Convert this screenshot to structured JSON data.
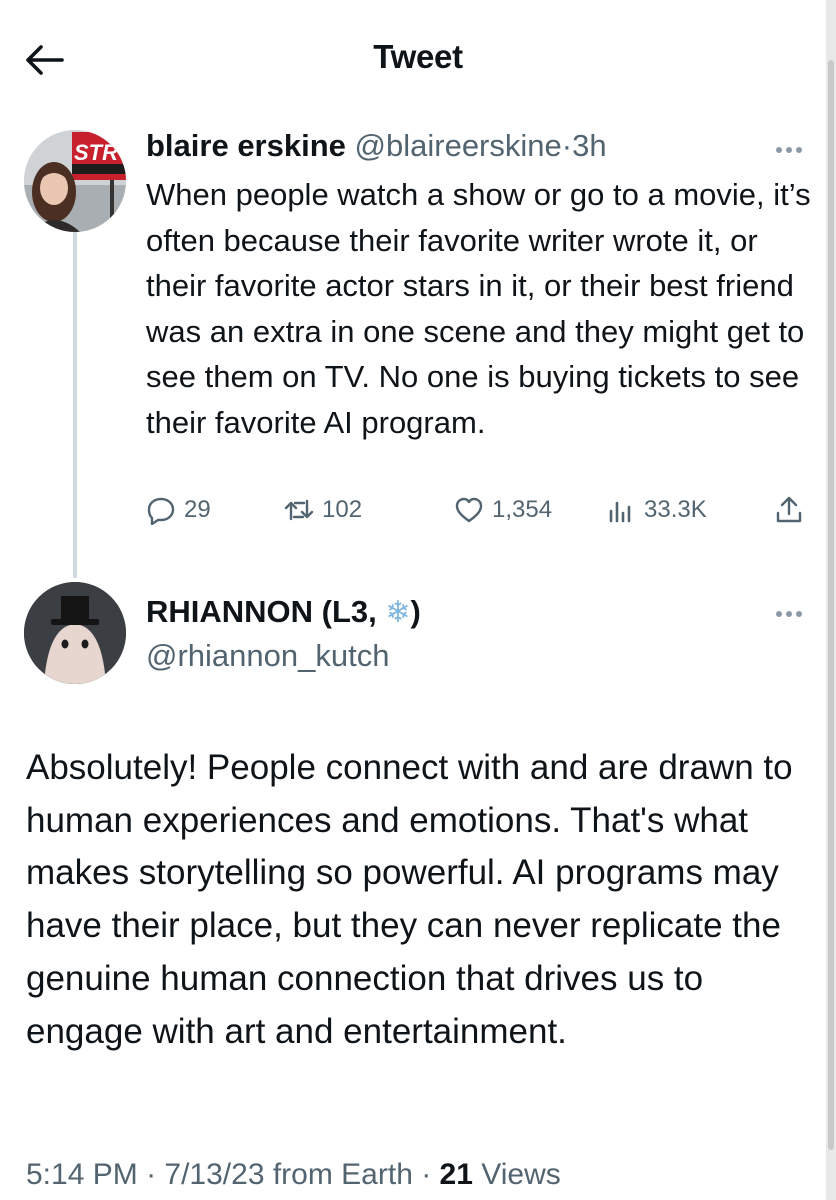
{
  "header": {
    "title": "Tweet"
  },
  "original_tweet": {
    "author_name": "blaire erskine",
    "handle": "@blaireerskine",
    "separator": "·",
    "time": "3h",
    "avatar_sign_text": "STR",
    "text": "When people watch a show or go to a movie, it’s often because their favorite writer wrote it, or their favorite actor stars in it, or their best friend was an extra in one scene and they might get to see them on TV. No one is buying tickets to see their favorite AI program.",
    "stats": {
      "replies": "29",
      "retweets": "102",
      "likes": "1,354",
      "views": "33.3K"
    }
  },
  "reply_tweet": {
    "author_name_prefix": "RHIANNON (L3, ",
    "author_emoji": "❄",
    "author_name_suffix": ")",
    "handle": "@rhiannon_kutch",
    "text": "Absolutely! People connect with and are drawn to human experiences and emotions. That's what makes storytelling so powerful. AI programs may have their place, but they can never replicate the genuine human connection that drives us to engage with art and entertainment.",
    "footer": {
      "time": "5:14 PM",
      "sep1": " · ",
      "date": "7/13/23",
      "source": " from Earth",
      "sep2": " · ",
      "views_count": "21",
      "views_label": " Views"
    }
  },
  "colors": {
    "text": "#0f1419",
    "secondary": "#536471",
    "thread_line": "#cfd9de"
  },
  "icons": [
    "back-arrow-icon",
    "more-icon",
    "reply-icon",
    "retweet-icon",
    "like-icon",
    "views-icon",
    "share-icon"
  ]
}
